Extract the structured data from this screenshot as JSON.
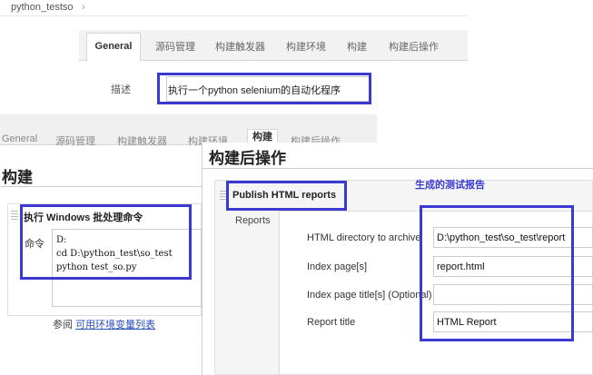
{
  "top": {
    "breadcrumb": "python_testso",
    "tabs": [
      "General",
      "源码管理",
      "构建触发器",
      "构建环境",
      "构建",
      "构建后操作"
    ],
    "description_label": "描述",
    "description_value": "执行一个python selenium的自动化程序"
  },
  "middle": {
    "tabs": [
      "General",
      "源码管理",
      "构建触发器",
      "构建环境",
      "构建",
      "构建后操作"
    ],
    "section_title": "构建",
    "step_title": "执行 Windows 批处理命令",
    "command_label": "命令",
    "command_lines": [
      "D:",
      "cd D:\\python_test\\so_test",
      "python test_so.py"
    ],
    "ref_prefix": "参阅",
    "ref_link": "可用环境变量列表"
  },
  "right": {
    "section_title": "构建后操作",
    "annotation": "生成的测试报告",
    "step_title": "Publish HTML reports",
    "reports_label": "Reports",
    "fields": [
      {
        "label": "HTML directory to archive",
        "value": "D:\\python_test\\so_test\\report"
      },
      {
        "label": "Index page[s]",
        "value": "report.html"
      },
      {
        "label": "Index page title[s] (Optional)",
        "value": ""
      },
      {
        "label": "Report title",
        "value": "HTML Report"
      }
    ]
  },
  "colors": {
    "highlight": "#3a3ad0",
    "link": "#2a4fb8"
  }
}
